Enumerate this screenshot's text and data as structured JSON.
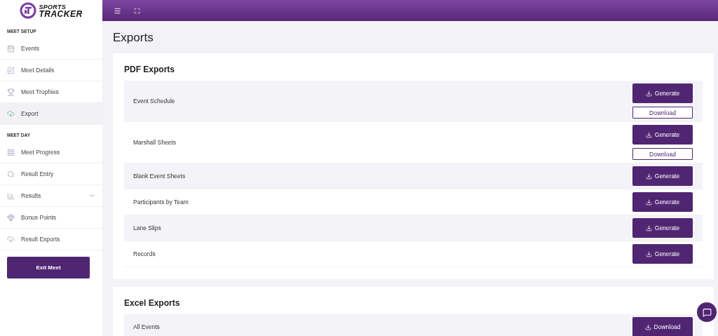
{
  "logo": {
    "line1": "SPORTS",
    "line2": "TRACKER"
  },
  "sidebar": {
    "sections": [
      {
        "title": "MEET SETUP",
        "items": [
          {
            "label": "Events",
            "kind": "calendar",
            "selected": false
          },
          {
            "label": "Meet Details",
            "kind": "edit",
            "selected": false
          },
          {
            "label": "Meet Trophies",
            "kind": "trophy",
            "selected": false
          },
          {
            "label": "Export",
            "kind": "cloud",
            "selected": true
          }
        ]
      },
      {
        "title": "MEET DAY",
        "items": [
          {
            "label": "Meet Progress",
            "kind": "grid",
            "selected": false
          },
          {
            "label": "Result Entry",
            "kind": "search",
            "selected": false
          },
          {
            "label": "Results",
            "kind": "chart",
            "selected": false,
            "expanded": false
          },
          {
            "label": "Bonus Points",
            "kind": "gem",
            "selected": false
          },
          {
            "label": "Result Exports",
            "kind": "cloud",
            "selected": false
          }
        ]
      }
    ],
    "exit_button": "Exit Meet"
  },
  "page_title": "Exports",
  "cards": [
    {
      "title": "PDF Exports",
      "rows": [
        {
          "label": "Event Schedule",
          "buttons": [
            {
              "kind": "filled",
              "label": "Generate"
            },
            {
              "kind": "outline",
              "label": "Download"
            }
          ]
        },
        {
          "label": "Marshall Sheets",
          "buttons": [
            {
              "kind": "filled",
              "label": "Generate"
            },
            {
              "kind": "outline",
              "label": "Download"
            }
          ]
        },
        {
          "label": "Blank Event Sheets",
          "buttons": [
            {
              "kind": "filled",
              "label": "Generate"
            }
          ]
        },
        {
          "label": "Participants by Team",
          "buttons": [
            {
              "kind": "filled",
              "label": "Generate"
            }
          ]
        },
        {
          "label": "Lane Slips",
          "buttons": [
            {
              "kind": "filled",
              "label": "Generate"
            }
          ]
        },
        {
          "label": "Records",
          "buttons": [
            {
              "kind": "filled",
              "label": "Generate"
            }
          ]
        }
      ]
    },
    {
      "title": "Excel Exports",
      "rows": [
        {
          "label": "All Events",
          "buttons": [
            {
              "kind": "filled",
              "label": "Download"
            }
          ]
        }
      ]
    }
  ]
}
